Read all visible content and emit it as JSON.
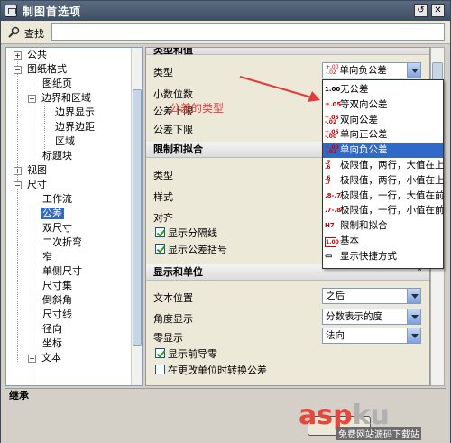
{
  "window": {
    "title": "制图首选项"
  },
  "search": {
    "label": "查找",
    "value": ""
  },
  "tree": {
    "items": [
      {
        "label": "公共"
      },
      {
        "label": "图纸格式"
      },
      {
        "label": "图纸页"
      },
      {
        "label": "边界和区域"
      },
      {
        "label": "边界显示"
      },
      {
        "label": "边界边距"
      },
      {
        "label": "区域"
      },
      {
        "label": "标题块"
      },
      {
        "label": "视图"
      },
      {
        "label": "尺寸"
      },
      {
        "label": "工作流"
      },
      {
        "label": "公差"
      },
      {
        "label": "双尺寸"
      },
      {
        "label": "二次折弯"
      },
      {
        "label": "窄"
      },
      {
        "label": "单侧尺寸"
      },
      {
        "label": "尺寸集"
      },
      {
        "label": "倒斜角"
      },
      {
        "label": "尺寸线"
      },
      {
        "label": "径向"
      },
      {
        "label": "坐标"
      },
      {
        "label": "文本"
      }
    ]
  },
  "panel": {
    "section1": {
      "title": "类型和值",
      "type_label": "类型",
      "type_value": "单向负公差",
      "decimals_label": "小数位数",
      "upper_label": "公差上限",
      "lower_label": "公差下限"
    },
    "section2": {
      "title": "限制和拟合",
      "type_label": "类型",
      "style_label": "样式",
      "align_label": "对齐",
      "show_separator": "显示分隔线",
      "show_brackets": "显示公差括号"
    },
    "section3": {
      "title": "显示和单位",
      "text_pos_label": "文本位置",
      "text_pos_value": "之后",
      "angle_label": "角度显示",
      "angle_value": "分数表示的度",
      "zero_label": "零显示",
      "zero_value": "法向",
      "show_leading_zero": "显示前导零",
      "convert_on_unit_change": "在更改单位时转换公差"
    }
  },
  "dropdown": {
    "items": [
      {
        "label": "无公差",
        "icon": "no-tolerance-icon"
      },
      {
        "label": "等双向公差",
        "icon": "equal-bilateral-icon"
      },
      {
        "label": "双向公差",
        "icon": "bilateral-icon"
      },
      {
        "label": "单向正公差",
        "icon": "unilateral-plus-icon"
      },
      {
        "label": "单向负公差",
        "icon": "unilateral-minus-icon"
      },
      {
        "label": "极限值，两行，大值在上",
        "icon": "limit-two-line-large-top-icon"
      },
      {
        "label": "极限值，两行，小值在上",
        "icon": "limit-two-line-small-top-icon"
      },
      {
        "label": "极限值，一行，大值在前",
        "icon": "limit-one-line-large-first-icon"
      },
      {
        "label": "极限值，一行，小值在前",
        "icon": "limit-one-line-small-first-icon"
      },
      {
        "label": "限制和拟合",
        "icon": "limit-fit-icon"
      },
      {
        "label": "基本",
        "icon": "basic-icon"
      },
      {
        "label": "显示快捷方式",
        "icon": "shortcut-arrow-icon"
      }
    ],
    "selected_index": 4
  },
  "annotation": {
    "text": "公差的类型"
  },
  "status": {
    "text": "继承"
  },
  "watermark": {
    "main": "asp",
    "ku": "ku",
    "sub": "免费网站源码下载站"
  },
  "colors": {
    "selection": "#3169c6",
    "titlebar": "#3d4d62",
    "annotation": "#e23b3b"
  }
}
